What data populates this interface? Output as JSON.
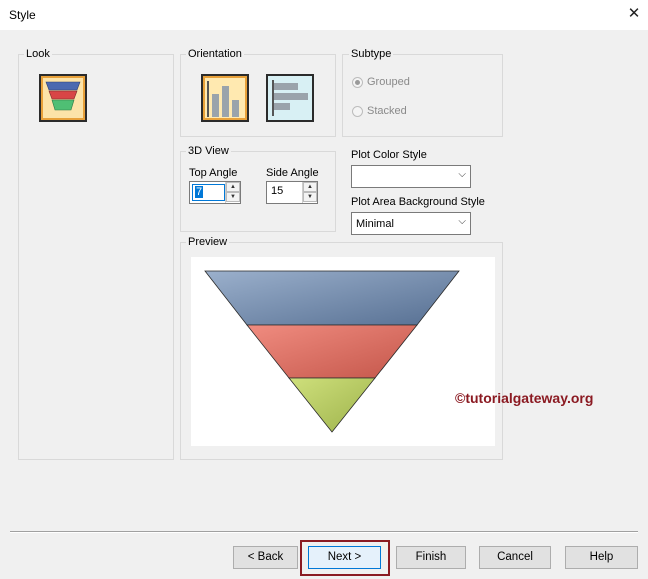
{
  "window": {
    "title": "Style",
    "close_glyph": "✕"
  },
  "look": {
    "label": "Look",
    "selected_icon": "funnel-chart-icon"
  },
  "orientation": {
    "label": "Orientation",
    "options": [
      "vertical-bars-icon",
      "horizontal-bars-icon"
    ],
    "selected": "vertical-bars-icon"
  },
  "subtype": {
    "label": "Subtype",
    "options": [
      {
        "label": "Grouped",
        "selected": true
      },
      {
        "label": "Stacked",
        "selected": false
      }
    ]
  },
  "view3d": {
    "label": "3D View",
    "top_angle_label": "Top Angle",
    "top_angle_value": "7",
    "side_angle_label": "Side Angle",
    "side_angle_value": "15"
  },
  "plot_color_style": {
    "label": "Plot Color Style",
    "value": ""
  },
  "plot_area_bg_style": {
    "label": "Plot Area Background Style",
    "value": "Minimal"
  },
  "preview": {
    "label": "Preview",
    "watermark": "©tutorialgateway.org",
    "colors": {
      "top": "#8aa0bd",
      "middle": "#e17a6c",
      "bottom": "#bcd06a"
    }
  },
  "buttons": {
    "back": "< Back",
    "next": "Next >",
    "finish": "Finish",
    "cancel": "Cancel",
    "help": "Help"
  },
  "colors": {
    "accent_select": "#e8a13a",
    "highlight_box": "#8b1a22",
    "focus_blue": "#0078d7"
  }
}
